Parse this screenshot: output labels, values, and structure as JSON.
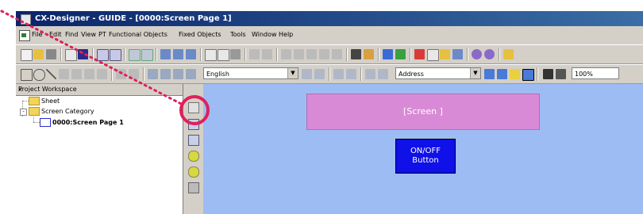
{
  "window": {
    "title": "CX-Designer - GUIDE - [0000:Screen Page 1]"
  },
  "menu": {
    "items": [
      "File",
      "Edit",
      "Find",
      "View",
      "PT",
      "Functional Objects",
      "Fixed Objects",
      "Tools",
      "Window",
      "Help"
    ]
  },
  "toolbar": {
    "language_combo": "English",
    "address_combo": "Address",
    "zoom_combo": "100%"
  },
  "workspace": {
    "header": "Project Workspace",
    "tree": [
      {
        "label": "Sheet",
        "type": "folder"
      },
      {
        "label": "Screen Category",
        "type": "folder"
      },
      {
        "label": "0000:Screen Page 1",
        "type": "screen"
      }
    ]
  },
  "canvas": {
    "screen_label": "[Screen ]",
    "button_line1": "ON/OFF",
    "button_line2": "Button"
  },
  "colors": {
    "titlebar": "#0a246a",
    "canvas": "#9ebcf4",
    "screen_box": "#d98ad6",
    "button": "#1010e8",
    "highlight": "#e0205a"
  }
}
